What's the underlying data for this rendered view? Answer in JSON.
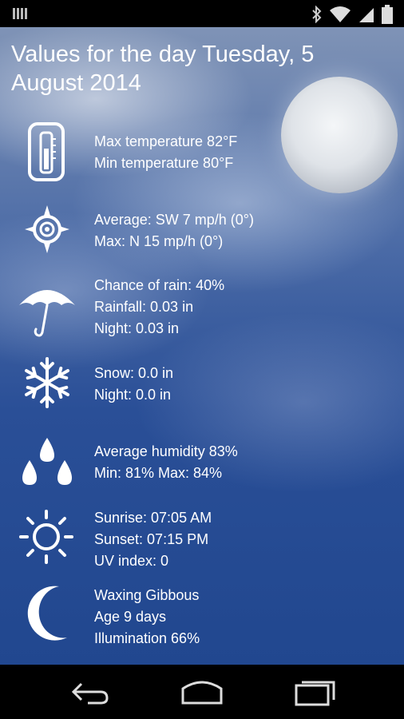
{
  "status_bar": {
    "left_icon": "signal-bars-icon",
    "icons": [
      "bluetooth-icon",
      "wifi-icon",
      "cell-signal-icon",
      "battery-icon"
    ]
  },
  "title": "Values for the day Tuesday, 5 August 2014",
  "rows": [
    {
      "icon": "thermometer-icon",
      "lines": [
        "Max temperature 82°F",
        "Min temperature 80°F"
      ]
    },
    {
      "icon": "wind-compass-icon",
      "lines": [
        "Average: SW 7 mp/h (0°)",
        "Max: N 15 mp/h (0°)"
      ]
    },
    {
      "icon": "umbrella-icon",
      "lines": [
        "Chance of rain: 40%",
        "Rainfall: 0.03 in",
        "Night: 0.03 in"
      ]
    },
    {
      "icon": "snowflake-icon",
      "lines": [
        "Snow: 0.0 in",
        "Night: 0.0 in"
      ]
    },
    {
      "icon": "humidity-drops-icon",
      "lines": [
        "Average humidity 83%",
        "Min: 81% Max: 84%"
      ]
    },
    {
      "icon": "sun-icon",
      "lines": [
        "Sunrise: 07:05 AM",
        "Sunset: 07:15 PM",
        "UV index: 0"
      ]
    },
    {
      "icon": "moon-phase-icon",
      "lines": [
        "Waxing Gibbous",
        "Age 9 days",
        "Illumination 66%"
      ]
    }
  ],
  "nav": {
    "buttons": [
      "back-icon",
      "home-icon",
      "recents-icon"
    ]
  }
}
